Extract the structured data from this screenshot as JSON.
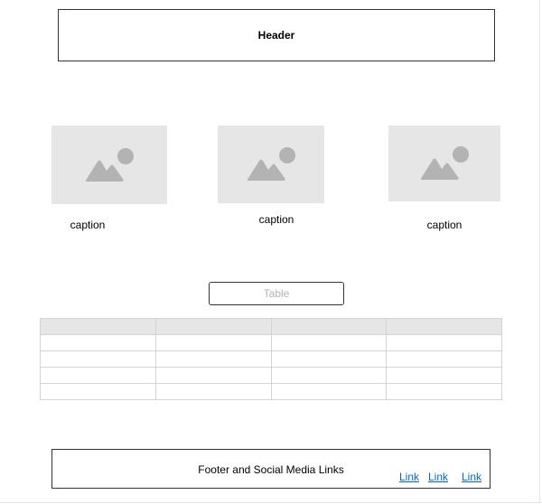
{
  "header": {
    "title": "Header"
  },
  "gallery": {
    "items": [
      {
        "icon": "image-placeholder-icon",
        "caption": "caption"
      },
      {
        "icon": "image-placeholder-icon",
        "caption": "caption"
      },
      {
        "icon": "image-placeholder-icon",
        "caption": "caption"
      }
    ]
  },
  "table_section": {
    "button_label": "Table",
    "columns": [
      "",
      "",
      "",
      ""
    ],
    "rows": [
      [
        "",
        "",
        "",
        ""
      ],
      [
        "",
        "",
        "",
        ""
      ],
      [
        "",
        "",
        "",
        ""
      ],
      [
        "",
        "",
        "",
        ""
      ]
    ]
  },
  "footer": {
    "title": "Footer and Social Media Links",
    "links": [
      "Link",
      "Link",
      "Link"
    ]
  },
  "colors": {
    "placeholder_fill": "#e6e6e6",
    "placeholder_icon": "#b3b3b3",
    "link": "#0066cc",
    "border": "#333333"
  }
}
